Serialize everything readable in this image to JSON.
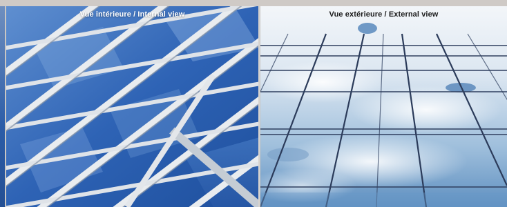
{
  "panels": {
    "internal": {
      "label": "Vue intérieure / Internal view",
      "image": "glass-roof-internal-photo"
    },
    "external": {
      "label": "Vue extérieure / External view",
      "image": "glass-facade-external-photo"
    }
  },
  "colors": {
    "glass_blue": "#2f66b3",
    "frame_white": "#e7eaee",
    "sky_light": "#dfe9f3",
    "facade_line": "#2b3b5a"
  }
}
